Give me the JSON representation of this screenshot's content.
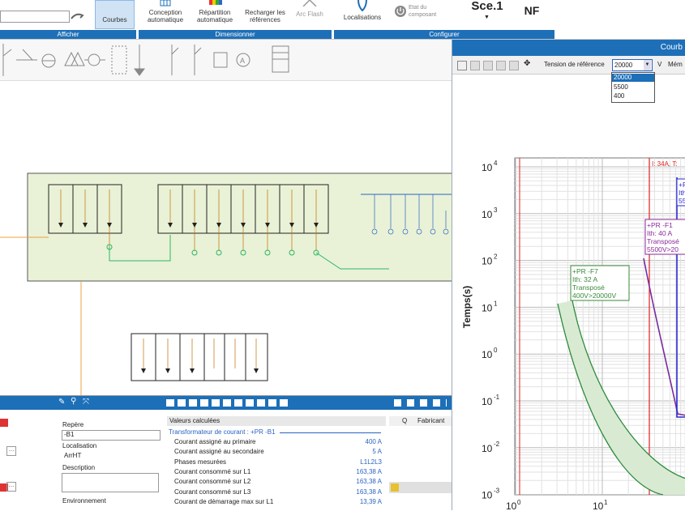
{
  "ribbon": {
    "courbes_label": "Courbes",
    "conception_label": "Conception automatique",
    "repartition_label": "Répartition automatique",
    "recharger_label": "Recharger les références",
    "arcflash_label": "Arc Flash",
    "localisations_label": "Localisations",
    "etat_label": "Etat du composant",
    "scenario_label": "Sce.1",
    "nf_label": "NF",
    "groups": {
      "afficher": "Afficher",
      "dimensionner": "Dimensionner",
      "configurer": "Configurer"
    }
  },
  "curve_panel": {
    "title": "Courb",
    "tension_label": "Tension de référence",
    "tension_value": "20000",
    "unit": "V",
    "memo_label": "Mém",
    "options": [
      "20000",
      "5500",
      "400"
    ],
    "selected_option": "20000"
  },
  "chart_data": {
    "type": "line",
    "ylabel": "Temps(s)",
    "yscale": "log",
    "ylim": [
      0.001,
      100000
    ],
    "xscale": "log",
    "y_ticks": [
      "10",
      "10",
      "10",
      "10",
      "10",
      "10",
      "10",
      "10"
    ],
    "y_exponents": [
      "4",
      "3",
      "2",
      "1",
      "0",
      "-1",
      "-2",
      "-3"
    ],
    "x_ticks": [
      "10",
      "10"
    ],
    "x_exponents": [
      "0",
      "1"
    ],
    "marker_label": "I: 34A, T:",
    "annotations": [
      {
        "lines": [
          "+PR -F7",
          "Ith: 32 A",
          "Transposé",
          "400V>20000V"
        ],
        "color": "#3a8a3a"
      },
      {
        "lines": [
          "+PR -F1",
          "Ith: 40 A",
          "Transposé",
          "5500V>20"
        ],
        "color": "#8a2a9a"
      },
      {
        "lines": [
          "+P",
          "Ith",
          "550"
        ],
        "color": "#2a2ad0"
      }
    ]
  },
  "properties": {
    "repere_label": "Repère",
    "repere_value": "-B1",
    "localisation_label": "Localisation",
    "localisation_value": "ArrHT",
    "description_label": "Description",
    "environnement_label": "Environnement"
  },
  "values": {
    "header": "Valeurs calculées",
    "section": "Transformateur de courant : +PR -B1",
    "rows": [
      {
        "label": "Courant assigné au primaire",
        "value": "400 A"
      },
      {
        "label": "Courant assigné au secondaire",
        "value": "5 A"
      },
      {
        "label": "Phases mesurées",
        "value": "L1L2L3"
      },
      {
        "label": "Courant consommé sur L1",
        "value": "163,38 A"
      },
      {
        "label": "Courant consommé sur L2",
        "value": "163,38 A"
      },
      {
        "label": "Courant consommé sur L3",
        "value": "163,38 A"
      },
      {
        "label": "Courant de démarrage max sur L1",
        "value": "13,39 A"
      }
    ]
  },
  "right_list": {
    "col_q": "Q",
    "col_fabricant": "Fabricant"
  }
}
